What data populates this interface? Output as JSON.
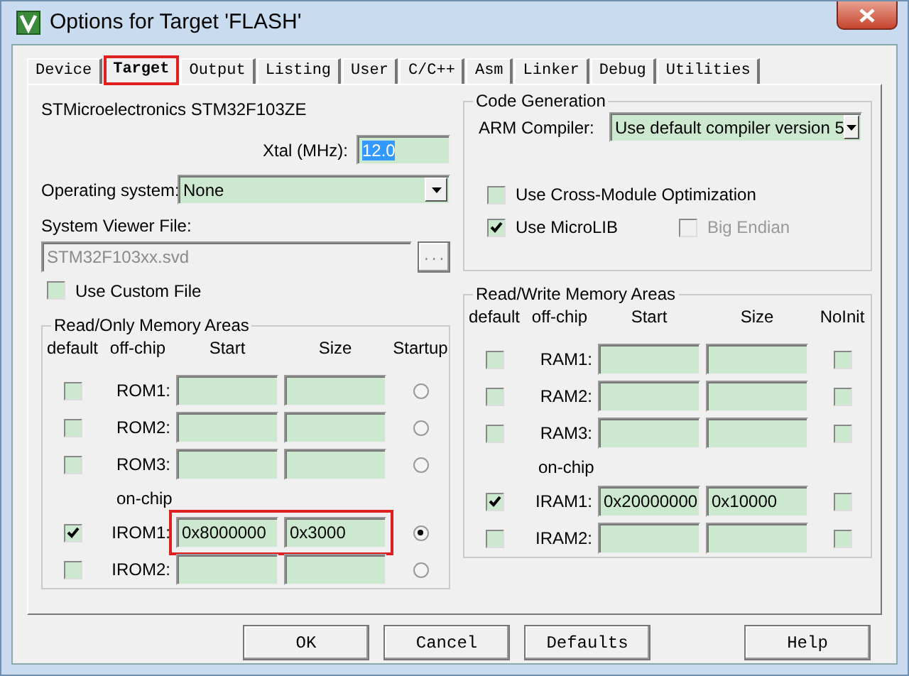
{
  "window": {
    "title": "Options for Target 'FLASH'"
  },
  "tabs": [
    {
      "label": "Device",
      "selected": false,
      "highlighted": false
    },
    {
      "label": "Target",
      "selected": true,
      "highlighted": true
    },
    {
      "label": "Output",
      "selected": false,
      "highlighted": false
    },
    {
      "label": "Listing",
      "selected": false,
      "highlighted": false
    },
    {
      "label": "User",
      "selected": false,
      "highlighted": false
    },
    {
      "label": "C/C++",
      "selected": false,
      "highlighted": false
    },
    {
      "label": "Asm",
      "selected": false,
      "highlighted": false
    },
    {
      "label": "Linker",
      "selected": false,
      "highlighted": false
    },
    {
      "label": "Debug",
      "selected": false,
      "highlighted": false
    },
    {
      "label": "Utilities",
      "selected": false,
      "highlighted": false
    }
  ],
  "device": "STMicroelectronics STM32F103ZE",
  "xtal": {
    "label": "Xtal (MHz):",
    "value": "12.0",
    "selected": true
  },
  "operating_system": {
    "label": "Operating system:",
    "value": "None"
  },
  "system_viewer_file": {
    "label": "System Viewer File:",
    "value": "STM32F103xx.svd",
    "disabled": true,
    "browse": "..."
  },
  "use_custom_file": {
    "label": "Use Custom File",
    "checked": false
  },
  "code_generation": {
    "title": "Code Generation",
    "compiler_label": "ARM Compiler:",
    "compiler": "Use default compiler version 5",
    "option_rows": [
      [
        {
          "label": "Use Cross-Module Optimization",
          "checked": false,
          "disabled": false
        }
      ],
      [
        {
          "label": "Use MicroLIB",
          "checked": true,
          "disabled": false
        },
        {
          "label": "Big Endian",
          "checked": false,
          "disabled": true
        }
      ]
    ]
  },
  "read_only_memory": {
    "title": "Read/Only Memory Areas",
    "columns": [
      "default",
      "off-chip",
      "Start",
      "Size",
      "Startup"
    ],
    "section_label": "on-chip",
    "off_chip_rows": [
      {
        "name": "ROM1:",
        "default": false,
        "selected": false,
        "highlighted": false
      },
      {
        "name": "ROM2:",
        "default": false,
        "selected": false,
        "highlighted": false
      },
      {
        "name": "ROM3:",
        "default": false,
        "selected": false,
        "highlighted": false
      }
    ],
    "on_chip_rows": [
      {
        "name": "IROM1:",
        "default": true,
        "start": "0x8000000",
        "size": "0x3000",
        "selected": true,
        "highlighted": true
      },
      {
        "name": "IROM2:",
        "default": false,
        "selected": false,
        "highlighted": false
      }
    ]
  },
  "read_write_memory": {
    "title": "Read/Write Memory Areas",
    "columns": [
      "default",
      "off-chip",
      "Start",
      "Size",
      "NoInit"
    ],
    "section_label": "on-chip",
    "off_chip_rows": [
      {
        "name": "RAM1:",
        "default": false,
        "noinit": false,
        "highlighted": false
      },
      {
        "name": "RAM2:",
        "default": false,
        "noinit": false,
        "highlighted": false
      },
      {
        "name": "RAM3:",
        "default": false,
        "noinit": false,
        "highlighted": false
      }
    ],
    "on_chip_rows": [
      {
        "name": "IRAM1:",
        "default": true,
        "start": "0x20000000",
        "size": "0x10000",
        "noinit": false,
        "highlighted": false
      },
      {
        "name": "IRAM2:",
        "default": false,
        "noinit": false,
        "highlighted": false
      }
    ]
  },
  "buttons": [
    "OK",
    "Cancel",
    "Defaults"
  ],
  "help_button": "Help"
}
